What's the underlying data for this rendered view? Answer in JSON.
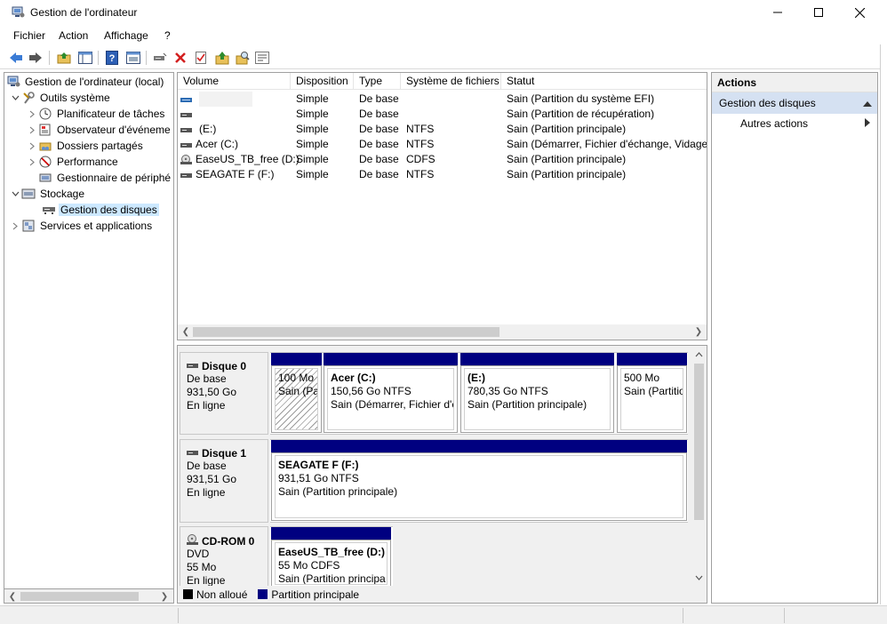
{
  "window": {
    "title": "Gestion de l'ordinateur",
    "app_icon": "computer-management-icon"
  },
  "menu": [
    "Fichier",
    "Action",
    "Affichage",
    "?"
  ],
  "toolbar": {
    "icons": [
      "back-arrow-icon",
      "forward-arrow-icon",
      "up-folder-icon",
      "show-hide-tree-icon",
      "help-icon",
      "properties-view-icon",
      "connect-drive-icon",
      "delete-icon",
      "check-icon",
      "up-arrow-icon",
      "search-folder-icon",
      "properties-icon"
    ]
  },
  "tree": {
    "items": [
      {
        "label": "Gestion de l'ordinateur (local)",
        "icon": "computer-management-icon",
        "expander": ""
      },
      {
        "label": "Outils système",
        "icon": "tools-icon",
        "expander": "expanded"
      },
      {
        "label": "Planificateur de tâches",
        "icon": "clock-icon",
        "expander": "collapsed"
      },
      {
        "label": "Observateur d'événeme",
        "icon": "event-viewer-icon",
        "expander": "collapsed"
      },
      {
        "label": "Dossiers partagés",
        "icon": "shared-folder-icon",
        "expander": "collapsed"
      },
      {
        "label": "Performance",
        "icon": "performance-icon",
        "expander": "collapsed"
      },
      {
        "label": "Gestionnaire de périphé",
        "icon": "device-manager-icon",
        "expander": ""
      },
      {
        "label": "Stockage",
        "icon": "storage-icon",
        "expander": "expanded"
      },
      {
        "label": "Gestion des disques",
        "icon": "disk-management-icon",
        "expander": ""
      },
      {
        "label": "Services et applications",
        "icon": "services-icon",
        "expander": "collapsed"
      }
    ]
  },
  "volumes": {
    "columns": [
      "Volume",
      "Disposition",
      "Type",
      "Système de fichiers",
      "Statut"
    ],
    "rows": [
      {
        "volume": "",
        "disposition": "Simple",
        "type": "De base",
        "fs": "",
        "status": "Sain (Partition du système EFI)",
        "icon": "efi-partition-icon"
      },
      {
        "volume": "",
        "disposition": "Simple",
        "type": "De base",
        "fs": "",
        "status": "Sain (Partition de récupération)",
        "icon": "drive-icon"
      },
      {
        "volume": "(E:)",
        "disposition": "Simple",
        "type": "De base",
        "fs": "NTFS",
        "status": "Sain (Partition principale)",
        "icon": "drive-icon"
      },
      {
        "volume": "Acer (C:)",
        "disposition": "Simple",
        "type": "De base",
        "fs": "NTFS",
        "status": "Sain (Démarrer, Fichier d'échange, Vidage s",
        "icon": "drive-icon"
      },
      {
        "volume": "EaseUS_TB_free (D:)",
        "disposition": "Simple",
        "type": "De base",
        "fs": "CDFS",
        "status": "Sain (Partition principale)",
        "icon": "cd-drive-icon"
      },
      {
        "volume": "SEAGATE F (F:)",
        "disposition": "Simple",
        "type": "De base",
        "fs": "NTFS",
        "status": "Sain (Partition principale)",
        "icon": "drive-icon"
      }
    ]
  },
  "disks": [
    {
      "name": "Disque 0",
      "lines": [
        "De base",
        "931,50 Go",
        "En ligne"
      ],
      "icon": "disk-icon",
      "partitions": [
        {
          "name": "",
          "lines": [
            "100 Mo",
            "Sain (Pa"
          ],
          "hatched": true
        },
        {
          "name": "Acer  (C:)",
          "lines": [
            "150,56 Go NTFS",
            "Sain (Démarrer, Fichier d'é"
          ]
        },
        {
          "name": "(E:)",
          "lines": [
            "780,35 Go NTFS",
            "Sain (Partition principale)"
          ]
        },
        {
          "name": "",
          "lines": [
            "500 Mo",
            "Sain (Partitio"
          ]
        }
      ]
    },
    {
      "name": "Disque 1",
      "lines": [
        "De base",
        "931,51 Go",
        "En ligne"
      ],
      "icon": "disk-icon",
      "partitions": [
        {
          "name": "SEAGATE F  (F:)",
          "lines": [
            "931,51 Go NTFS",
            "Sain (Partition principale)"
          ]
        }
      ]
    },
    {
      "name": "CD-ROM 0",
      "lines": [
        "DVD",
        "55 Mo",
        "En ligne"
      ],
      "icon": "cd-icon",
      "partitions": [
        {
          "name": "EaseUS_TB_free  (D:)",
          "lines": [
            "55 Mo CDFS",
            "Sain (Partition principa"
          ]
        }
      ]
    }
  ],
  "legend": [
    {
      "label": "Non alloué",
      "color": "#000000"
    },
    {
      "label": "Partition principale",
      "color": "#000080"
    }
  ],
  "actions": {
    "header": "Actions",
    "section": "Gestion des disques",
    "items": [
      "Autres actions"
    ]
  }
}
